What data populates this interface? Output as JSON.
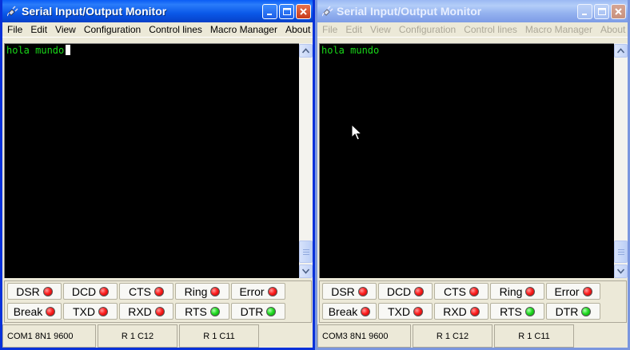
{
  "windows": [
    {
      "title": "Serial Input/Output Monitor",
      "active": true,
      "menu": [
        "File",
        "Edit",
        "View",
        "Configuration",
        "Control lines",
        "Macro Manager",
        "About"
      ],
      "terminal_text": "hola mundo",
      "lines_row1": [
        {
          "label": "DSR",
          "led": "red"
        },
        {
          "label": "DCD",
          "led": "red"
        },
        {
          "label": "CTS",
          "led": "red"
        },
        {
          "label": "Ring",
          "led": "red"
        },
        {
          "label": "Error",
          "led": "red"
        }
      ],
      "lines_row2": [
        {
          "label": "Break",
          "led": "red"
        },
        {
          "label": "TXD",
          "led": "red"
        },
        {
          "label": "RXD",
          "led": "red"
        },
        {
          "label": "RTS",
          "led": "green"
        },
        {
          "label": "DTR",
          "led": "green"
        }
      ],
      "status": {
        "port": "COM1 8N1 9600",
        "pos1": "R 1 C12",
        "pos2": "R 1 C11"
      }
    },
    {
      "title": "Serial Input/Output Monitor",
      "active": false,
      "menu": [
        "File",
        "Edit",
        "View",
        "Configuration",
        "Control lines",
        "Macro Manager",
        "About"
      ],
      "terminal_text": "hola mundo",
      "lines_row1": [
        {
          "label": "DSR",
          "led": "red"
        },
        {
          "label": "DCD",
          "led": "red"
        },
        {
          "label": "CTS",
          "led": "red"
        },
        {
          "label": "Ring",
          "led": "red"
        },
        {
          "label": "Error",
          "led": "red"
        }
      ],
      "lines_row2": [
        {
          "label": "Break",
          "led": "red"
        },
        {
          "label": "TXD",
          "led": "red"
        },
        {
          "label": "RXD",
          "led": "red"
        },
        {
          "label": "RTS",
          "led": "green"
        },
        {
          "label": "DTR",
          "led": "green"
        }
      ],
      "status": {
        "port": "COM3 8N1 9600",
        "pos1": "R 1 C12",
        "pos2": "R 1 C11"
      }
    }
  ],
  "colors": {
    "terminal_bg": "#000000",
    "terminal_fg": "#19d919",
    "led_on_green": "#22dd22",
    "led_off_red": "#ff2020"
  },
  "icons": {
    "app": "plug-icon",
    "minimize": "minimize-icon",
    "maximize": "maximize-icon",
    "close": "close-icon"
  }
}
